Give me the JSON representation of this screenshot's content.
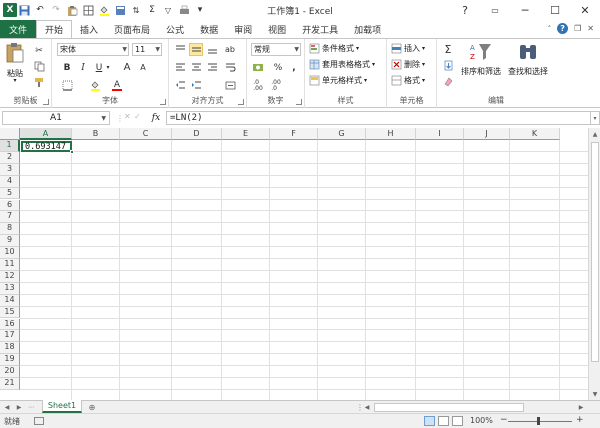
{
  "window": {
    "title": "工作簿1 - Excel",
    "minimize_glyph": "─",
    "maximize_glyph": "☐",
    "close_glyph": "✕"
  },
  "qat": {
    "save_glyph": "💾",
    "undo_glyph": "↶",
    "redo_glyph": "↷",
    "sum_glyph": "Σ",
    "more_glyph": "▾"
  },
  "tabs": {
    "file": "文件",
    "items": [
      "开始",
      "插入",
      "页面布局",
      "公式",
      "数据",
      "审阅",
      "视图",
      "开发工具",
      "加载项"
    ]
  },
  "ribbon": {
    "clipboard": {
      "label": "剪贴板",
      "paste": "粘贴"
    },
    "font": {
      "label": "字体",
      "name": "宋体",
      "size": "11",
      "bold": "B",
      "italic": "I",
      "underline": "U",
      "grow": "A",
      "shrink": "A",
      "font_color": "A"
    },
    "alignment": {
      "label": "对齐方式"
    },
    "number": {
      "label": "数字",
      "format": "常规",
      "percent": "%",
      "comma": ","
    },
    "styles": {
      "label": "样式",
      "conditional": "条件格式",
      "table": "套用表格格式",
      "cell": "单元格样式"
    },
    "cells": {
      "label": "单元格",
      "insert": "插入",
      "delete": "删除",
      "format": "格式"
    },
    "editing": {
      "label": "编辑",
      "sum": "Σ",
      "sort": "排序和筛选",
      "find": "查找和选择"
    }
  },
  "formula_bar": {
    "name_box": "A1",
    "fx": "fx",
    "formula": "=LN(2)"
  },
  "grid": {
    "columns": [
      "A",
      "B",
      "C",
      "D",
      "E",
      "F",
      "G",
      "H",
      "I",
      "J",
      "K"
    ],
    "rows": [
      "1",
      "2",
      "3",
      "4",
      "5",
      "6",
      "7",
      "8",
      "9",
      "10",
      "11",
      "12",
      "13",
      "14",
      "15",
      "16",
      "17",
      "18",
      "19",
      "20",
      "21"
    ],
    "a1_value": "0.693147"
  },
  "sheets": {
    "active": "Sheet1"
  },
  "status": {
    "ready": "就绪",
    "zoom": "100%",
    "zoom_minus": "−",
    "zoom_plus": "+"
  },
  "colors": {
    "accent": "#217346",
    "file_tab": "#1e7145"
  }
}
